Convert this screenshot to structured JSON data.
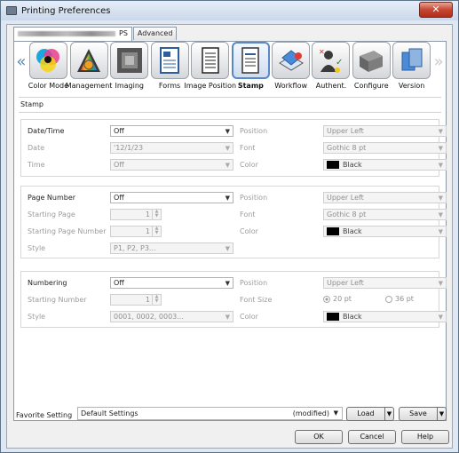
{
  "window": {
    "title": "Printing Preferences",
    "close_label": "✕"
  },
  "tabs": [
    {
      "label": "PS",
      "active": true
    },
    {
      "label": "Advanced",
      "active": false
    }
  ],
  "iconbar": {
    "left_arrow": "«",
    "right_arrow": "»",
    "items": [
      {
        "label": "Color Mode",
        "icon": "color-mode-icon"
      },
      {
        "label": "Management",
        "icon": "management-icon"
      },
      {
        "label": "Imaging",
        "icon": "imaging-icon"
      },
      {
        "label": "Forms",
        "icon": "forms-icon"
      },
      {
        "label": "Image Position",
        "icon": "image-position-icon"
      },
      {
        "label": "Stamp",
        "icon": "stamp-icon",
        "selected": true
      },
      {
        "label": "Workflow",
        "icon": "workflow-icon"
      },
      {
        "label": "Authent.",
        "icon": "authentication-icon"
      },
      {
        "label": "Configure",
        "icon": "configure-icon"
      },
      {
        "label": "Version",
        "icon": "version-icon"
      }
    ]
  },
  "section_label": "Stamp",
  "datetime": {
    "label": "Date/Time",
    "value": "Off",
    "date_label": "Date",
    "date_value": "'12/1/23",
    "time_label": "Time",
    "time_value": "Off",
    "position_label": "Position",
    "position_value": "Upper Left",
    "font_label": "Font",
    "font_value": "Gothic 8 pt",
    "color_label": "Color",
    "color_value": "Black"
  },
  "pagenumber": {
    "label": "Page Number",
    "value": "Off",
    "starting_page_label": "Starting Page",
    "starting_page_value": "1",
    "starting_page_number_label": "Starting Page Number",
    "starting_page_number_value": "1",
    "style_label": "Style",
    "style_value": "P1, P2, P3...",
    "position_label": "Position",
    "position_value": "Upper Left",
    "font_label": "Font",
    "font_value": "Gothic 8 pt",
    "color_label": "Color",
    "color_value": "Black"
  },
  "numbering": {
    "label": "Numbering",
    "value": "Off",
    "starting_number_label": "Starting Number",
    "starting_number_value": "1",
    "style_label": "Style",
    "style_value": "0001, 0002, 0003...",
    "position_label": "Position",
    "position_value": "Upper Left",
    "fontsize_label": "Font Size",
    "fontsize_option1": "20 pt",
    "fontsize_option2": "36 pt",
    "color_label": "Color",
    "color_value": "Black"
  },
  "favorite": {
    "label": "Favorite Setting",
    "value": "Default Settings",
    "modified": "(modified)",
    "load_label": "Load",
    "save_label": "Save"
  },
  "footer": {
    "ok": "OK",
    "cancel": "Cancel",
    "help": "Help"
  }
}
